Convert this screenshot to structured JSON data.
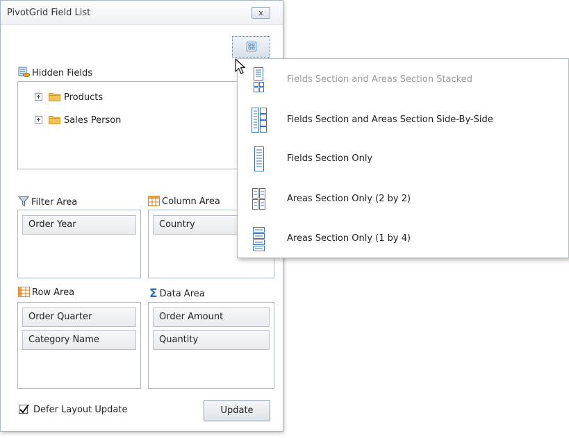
{
  "window": {
    "title": "PivotGrid Field List",
    "close_label": "x"
  },
  "hidden_fields": {
    "label": "Hidden Fields",
    "items": [
      {
        "label": "Products"
      },
      {
        "label": "Sales Person"
      }
    ]
  },
  "filter_area": {
    "label": "Filter Area",
    "fields": [
      "Order Year"
    ]
  },
  "column_area": {
    "label": "Column Area",
    "fields": [
      "Country"
    ]
  },
  "row_area": {
    "label": "Row Area",
    "fields": [
      "Order Quarter",
      "Category Name"
    ]
  },
  "data_area": {
    "label": "Data Area",
    "fields": [
      "Order Amount",
      "Quantity"
    ]
  },
  "footer": {
    "defer_label": "Defer Layout Update",
    "defer_checked": true,
    "update_label": "Update"
  },
  "layout_menu": {
    "items": [
      {
        "label": "Fields Section and Areas Section Stacked",
        "icon": "stacked-layout-icon",
        "disabled": true
      },
      {
        "label": "Fields Section and Areas Section Side-By-Side",
        "icon": "side-by-side-layout-icon",
        "disabled": false
      },
      {
        "label": "Fields Section Only",
        "icon": "fields-only-layout-icon",
        "disabled": false
      },
      {
        "label": "Areas Section Only (2 by 2)",
        "icon": "areas-2x2-layout-icon",
        "disabled": false
      },
      {
        "label": "Areas Section Only (1 by 4)",
        "icon": "areas-1x4-layout-icon",
        "disabled": false
      }
    ]
  },
  "colors": {
    "accent": "#2f6fb5",
    "border": "#a9b3c0",
    "folder": "#e8b84a",
    "disabled_text": "#9a9a9a"
  }
}
